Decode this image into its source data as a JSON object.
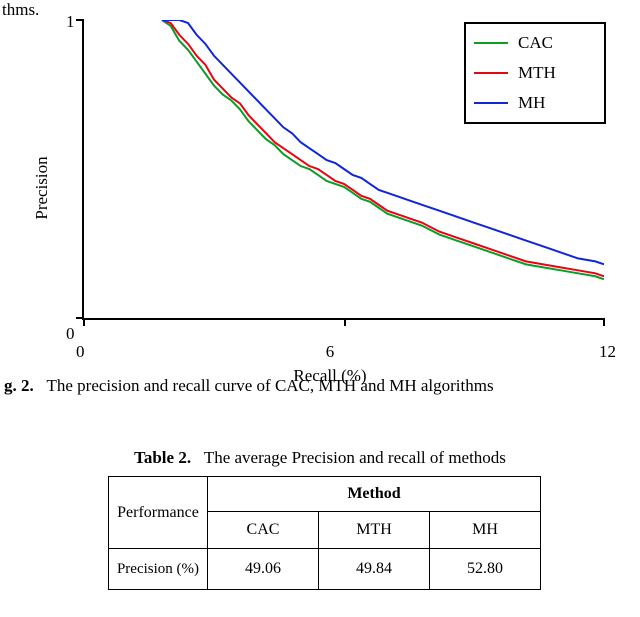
{
  "fragment_top": "thms.",
  "chart_data": {
    "type": "line",
    "xlabel": "Recall (%)",
    "ylabel": "Precision",
    "xlim": [
      0,
      12
    ],
    "ylim": [
      0,
      1
    ],
    "xticks": [
      0,
      6,
      12
    ],
    "yticks": [
      0,
      1
    ],
    "x": [
      1.8,
      2.0,
      2.2,
      2.4,
      2.6,
      2.8,
      3.0,
      3.2,
      3.4,
      3.6,
      3.8,
      4.0,
      4.2,
      4.4,
      4.6,
      4.8,
      5.0,
      5.2,
      5.4,
      5.6,
      5.8,
      6.0,
      6.2,
      6.4,
      6.6,
      6.8,
      7.0,
      7.4,
      7.8,
      8.2,
      8.6,
      9.0,
      9.4,
      9.8,
      10.2,
      10.6,
      11.0,
      11.4,
      11.8,
      12.0
    ],
    "series": [
      {
        "name": "CAC",
        "color": "#0E9B27",
        "values": [
          1.0,
          0.98,
          0.93,
          0.9,
          0.86,
          0.82,
          0.78,
          0.75,
          0.73,
          0.7,
          0.66,
          0.63,
          0.6,
          0.58,
          0.55,
          0.53,
          0.51,
          0.5,
          0.48,
          0.46,
          0.45,
          0.44,
          0.42,
          0.4,
          0.39,
          0.37,
          0.35,
          0.33,
          0.31,
          0.28,
          0.26,
          0.24,
          0.22,
          0.2,
          0.18,
          0.17,
          0.16,
          0.15,
          0.14,
          0.13
        ]
      },
      {
        "name": "MTH",
        "color": "#E30613",
        "values": [
          1.0,
          0.99,
          0.95,
          0.92,
          0.88,
          0.85,
          0.8,
          0.77,
          0.74,
          0.72,
          0.68,
          0.65,
          0.62,
          0.59,
          0.57,
          0.55,
          0.53,
          0.51,
          0.5,
          0.48,
          0.46,
          0.45,
          0.43,
          0.41,
          0.4,
          0.38,
          0.36,
          0.34,
          0.32,
          0.29,
          0.27,
          0.25,
          0.23,
          0.21,
          0.19,
          0.18,
          0.17,
          0.16,
          0.15,
          0.14
        ]
      },
      {
        "name": "MH",
        "color": "#1227D4",
        "values": [
          1.0,
          1.0,
          1.0,
          0.99,
          0.95,
          0.92,
          0.88,
          0.85,
          0.82,
          0.79,
          0.76,
          0.73,
          0.7,
          0.67,
          0.64,
          0.62,
          0.59,
          0.57,
          0.55,
          0.53,
          0.52,
          0.5,
          0.48,
          0.47,
          0.45,
          0.43,
          0.42,
          0.4,
          0.38,
          0.36,
          0.34,
          0.32,
          0.3,
          0.28,
          0.26,
          0.24,
          0.22,
          0.2,
          0.19,
          0.18
        ]
      }
    ],
    "legend": [
      "CAC",
      "MTH",
      "MH"
    ]
  },
  "fig_caption_prefix": "g. 2.",
  "fig_caption_text": "The precision and recall curve of CAC, MTH and MH algorithms",
  "table_caption_prefix": "Table 2.",
  "table_caption_text": "The average Precision and recall of methods",
  "table": {
    "row_header": "Performance",
    "col_group": "Method",
    "cols": [
      "CAC",
      "MTH",
      "MH"
    ],
    "rows": [
      {
        "name": "Precision (%)",
        "values": [
          "49.06",
          "49.84",
          "52.80"
        ]
      }
    ]
  }
}
